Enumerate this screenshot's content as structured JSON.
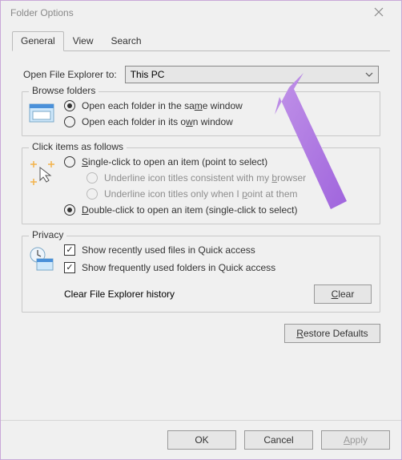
{
  "window": {
    "title": "Folder Options"
  },
  "tabs": {
    "general": "General",
    "view": "View",
    "search": "Search"
  },
  "open_row": {
    "label": "Open File Explorer to:",
    "value": "This PC"
  },
  "browse": {
    "legend": "Browse folders",
    "same_pre": "Open each folder in the sa",
    "same_u": "m",
    "same_post": "e window",
    "own_pre": "Open each folder in its o",
    "own_u": "w",
    "own_post": "n window"
  },
  "click": {
    "legend": "Click items as follows",
    "single_u": "S",
    "single_post": "ingle-click to open an item (point to select)",
    "uicons_pre": "Underline icon titles consistent with my ",
    "uicons_u": "b",
    "uicons_post": "rowser",
    "upoint_pre": "Underline icon titles only when I ",
    "upoint_u": "p",
    "upoint_post": "oint at them",
    "double_u": "D",
    "double_post": "ouble-click to open an item (single-click to select)"
  },
  "privacy": {
    "legend": "Privacy",
    "recent": "Show recently used files in Quick access",
    "frequent": "Show frequently used folders in Quick access",
    "clear_label": "Clear File Explorer history",
    "clear_u": "C",
    "clear_post": "lear"
  },
  "restore": {
    "u": "R",
    "post": "estore Defaults"
  },
  "footer": {
    "ok": "OK",
    "cancel": "Cancel",
    "apply_u": "A",
    "apply_post": "pply"
  }
}
